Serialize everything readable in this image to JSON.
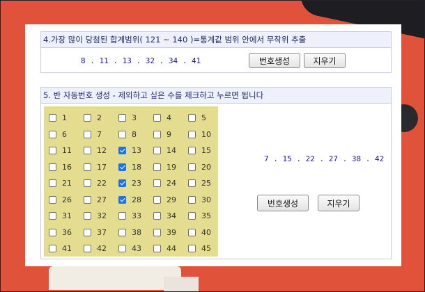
{
  "section4": {
    "header": "4.가장 많이 당첨된 합계범위( 121 ~ 140 )=통계값 범위 안에서 무작위 추출",
    "result": "8 . 11 . 13 . 32 . 34 . 41",
    "generate_label": "번호생성",
    "clear_label": "지우기"
  },
  "section5": {
    "header": "5. 반 자동번호 생성 - 제외하고 싶은 수를 체크하고 누르면 됩니다",
    "result": "7 . 15 . 22 . 27 . 38 . 42",
    "generate_label": "번호생성",
    "clear_label": "지우기",
    "numbers": [
      {
        "n": "1",
        "checked": false
      },
      {
        "n": "2",
        "checked": false
      },
      {
        "n": "3",
        "checked": false
      },
      {
        "n": "4",
        "checked": false
      },
      {
        "n": "5",
        "checked": false
      },
      {
        "n": "6",
        "checked": false
      },
      {
        "n": "7",
        "checked": false
      },
      {
        "n": "8",
        "checked": false
      },
      {
        "n": "9",
        "checked": false
      },
      {
        "n": "10",
        "checked": false
      },
      {
        "n": "11",
        "checked": false
      },
      {
        "n": "12",
        "checked": false
      },
      {
        "n": "13",
        "checked": true
      },
      {
        "n": "14",
        "checked": false
      },
      {
        "n": "15",
        "checked": false
      },
      {
        "n": "16",
        "checked": false
      },
      {
        "n": "17",
        "checked": false
      },
      {
        "n": "18",
        "checked": true
      },
      {
        "n": "19",
        "checked": false
      },
      {
        "n": "20",
        "checked": false
      },
      {
        "n": "21",
        "checked": false
      },
      {
        "n": "22",
        "checked": false
      },
      {
        "n": "23",
        "checked": true
      },
      {
        "n": "24",
        "checked": false
      },
      {
        "n": "25",
        "checked": false
      },
      {
        "n": "26",
        "checked": false
      },
      {
        "n": "27",
        "checked": false
      },
      {
        "n": "28",
        "checked": true
      },
      {
        "n": "29",
        "checked": false
      },
      {
        "n": "30",
        "checked": false
      },
      {
        "n": "31",
        "checked": false
      },
      {
        "n": "32",
        "checked": false
      },
      {
        "n": "33",
        "checked": false
      },
      {
        "n": "34",
        "checked": false
      },
      {
        "n": "35",
        "checked": false
      },
      {
        "n": "36",
        "checked": false
      },
      {
        "n": "37",
        "checked": false
      },
      {
        "n": "38",
        "checked": false
      },
      {
        "n": "39",
        "checked": false
      },
      {
        "n": "40",
        "checked": false
      },
      {
        "n": "41",
        "checked": false
      },
      {
        "n": "42",
        "checked": false
      },
      {
        "n": "43",
        "checked": false
      },
      {
        "n": "44",
        "checked": false
      },
      {
        "n": "45",
        "checked": false
      }
    ]
  }
}
